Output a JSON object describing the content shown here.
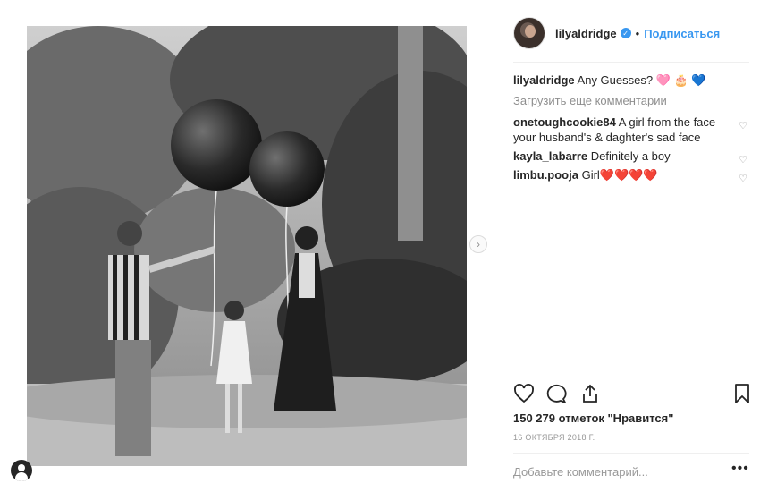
{
  "post": {
    "username": "lilyaldridge",
    "separator": "•",
    "follow_label": "Подписаться",
    "caption_text": "Any Guesses?",
    "caption_emoji": "🩷 🎂 💙",
    "load_more_label": "Загрузить еще комментарии",
    "comments": [
      {
        "user": "onetoughcookie84",
        "text": "A girl from the face your husband's & daghter's sad face"
      },
      {
        "user": "kayla_labarre",
        "text": "Definitely a boy"
      },
      {
        "user": "limbu.pooja",
        "text": "Girl❤️❤️❤️❤️"
      }
    ],
    "likes_label": "150 279 отметок \"Нравится\"",
    "date_label": "16 ОКТЯБРЯ 2018 Г.",
    "add_comment_placeholder": "Добавьте комментарий...",
    "more_label": "•••"
  },
  "icons": {
    "verified": "verified-badge-icon",
    "like": "heart-icon",
    "comment": "comment-bubble-icon",
    "share": "share-icon",
    "save": "bookmark-icon",
    "comment_like": "heart-outline-icon",
    "carousel_next": "chevron-right-icon",
    "user": "user-profile-icon"
  },
  "colors": {
    "accent": "#3897f0",
    "text": "#262626",
    "muted": "#8e8e8e",
    "divider": "#efefef"
  }
}
